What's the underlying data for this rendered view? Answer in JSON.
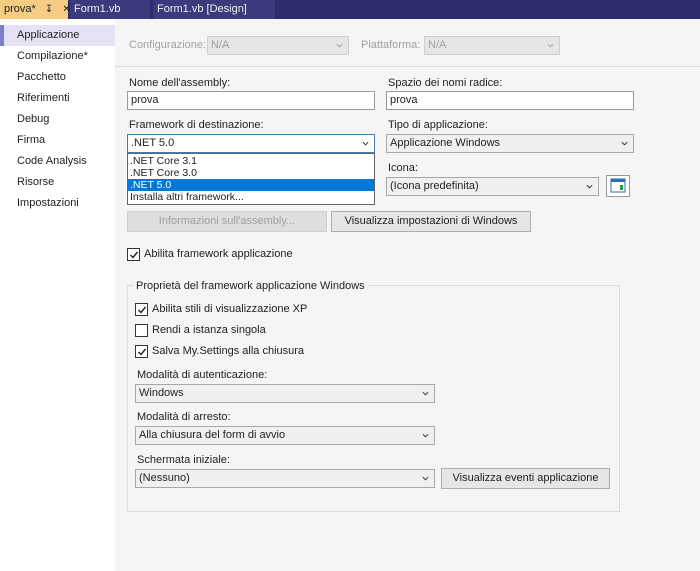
{
  "tabs": [
    {
      "label": "prova*",
      "pin": "↧",
      "close": "✕"
    },
    {
      "label": "Form1.vb"
    },
    {
      "label": "Form1.vb [Design]"
    }
  ],
  "sidebar": {
    "items": [
      {
        "label": "Applicazione"
      },
      {
        "label": "Compilazione*"
      },
      {
        "label": "Pacchetto"
      },
      {
        "label": "Riferimenti"
      },
      {
        "label": "Debug"
      },
      {
        "label": "Firma"
      },
      {
        "label": "Code Analysis"
      },
      {
        "label": "Risorse"
      },
      {
        "label": "Impostazioni"
      }
    ]
  },
  "config": {
    "configurazione_label": "Configurazione:",
    "configurazione_value": "N/A",
    "piattaforma_label": "Piattaforma:",
    "piattaforma_value": "N/A"
  },
  "form": {
    "assembly_name_label": "Nome dell'assembly:",
    "assembly_name_value": "prova",
    "root_namespace_label": "Spazio dei nomi radice:",
    "root_namespace_value": "prova",
    "target_framework_label": "Framework di destinazione:",
    "target_framework_value": ".NET 5.0",
    "app_type_label": "Tipo di applicazione:",
    "app_type_value": "Applicazione Windows",
    "icon_label": "Icona:",
    "icon_value": "(Icona predefinita)",
    "assembly_info_button": "Informazioni sull'assembly...",
    "windows_settings_button": "Visualizza impostazioni di Windows",
    "enable_app_framework_label": "Abilita framework applicazione",
    "enable_app_framework_checked": true
  },
  "framework_dropdown": {
    "options": [
      {
        "label": ".NET Core 3.1",
        "selected": false
      },
      {
        "label": ".NET Core 3.0",
        "selected": false
      },
      {
        "label": ".NET 5.0",
        "selected": true
      },
      {
        "label": "Installa altri framework...",
        "selected": false
      }
    ]
  },
  "group": {
    "title": "Proprietà del framework applicazione Windows",
    "xp_styles_label": "Abilita stili di visualizzazione XP",
    "xp_styles_checked": true,
    "single_instance_label": "Rendi a istanza singola",
    "single_instance_checked": false,
    "save_settings_label": "Salva My.Settings alla chiusura",
    "save_settings_checked": true,
    "auth_mode_label": "Modalità di autenticazione:",
    "auth_mode_value": "Windows",
    "shutdown_mode_label": "Modalità di arresto:",
    "shutdown_mode_value": "Alla chiusura del form di avvio",
    "splash_label": "Schermata iniziale:",
    "splash_value": "(Nessuno)",
    "app_events_button": "Visualizza eventi applicazione"
  },
  "colors": {
    "tabbar": "#2d2d6e",
    "active_tab": "#f5cc84",
    "selection": "#0078d7",
    "nav_selected": "#e3e3f5"
  }
}
